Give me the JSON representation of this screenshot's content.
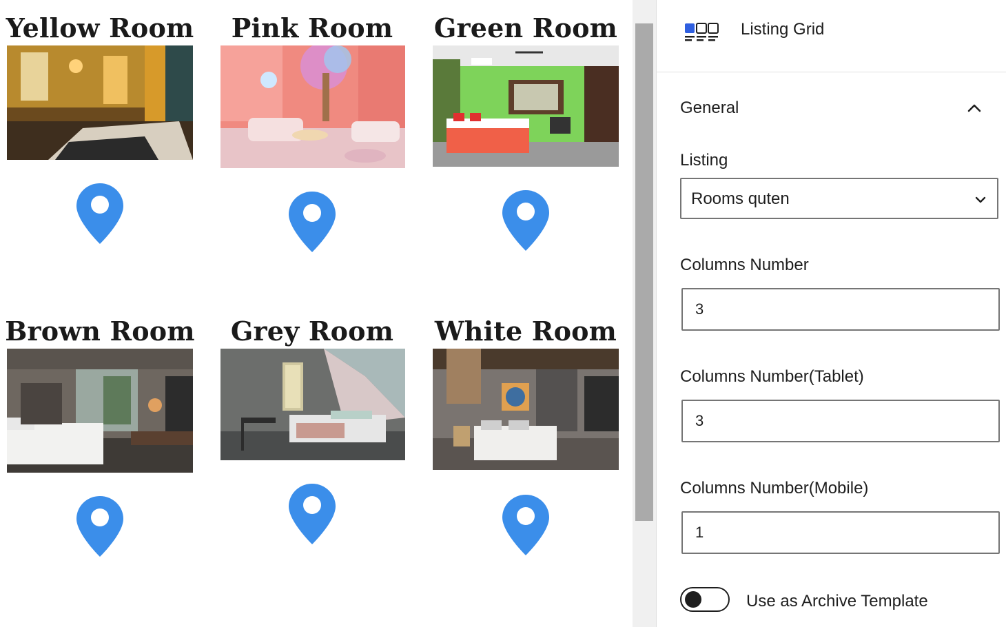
{
  "listing": {
    "cards": [
      {
        "title": "Yellow Room"
      },
      {
        "title": "Pink Room"
      },
      {
        "title": "Green Room"
      },
      {
        "title": "Brown Room"
      },
      {
        "title": "Grey Room"
      },
      {
        "title": "White Room"
      }
    ]
  },
  "colors": {
    "pin": "#3b8eea",
    "accent_text": "#1e1e1e",
    "scroll_thumb": "#aaaaaa"
  },
  "sidebar": {
    "block_title": "Listing Grid",
    "block_icon": "listing-grid-icon",
    "panel_title": "General",
    "listing_label": "Listing",
    "listing_value": "Rooms quten",
    "columns_label": "Columns Number",
    "columns_value": "3",
    "columns_tablet_label": "Columns Number(Tablet)",
    "columns_tablet_value": "3",
    "columns_mobile_label": "Columns Number(Mobile)",
    "columns_mobile_value": "1",
    "archive_toggle_label": "Use as Archive Template",
    "archive_toggle_on": false
  }
}
